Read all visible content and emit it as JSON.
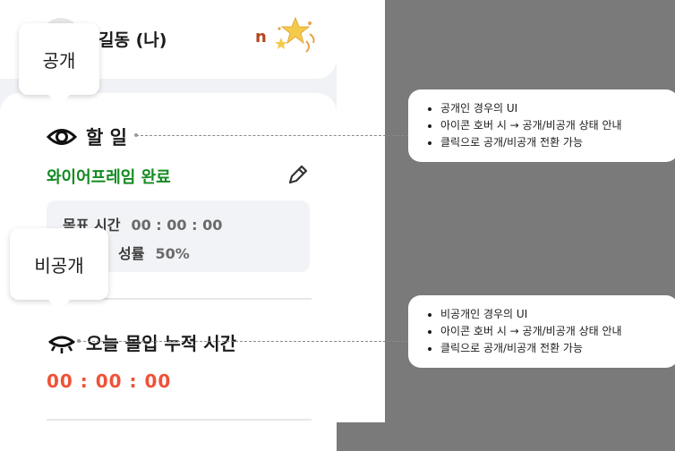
{
  "user": {
    "name": "길동 (나)",
    "mark": "n",
    "sparkle_icon": "sparkle-star-icon"
  },
  "task": {
    "title": "할 일",
    "status": "와이어프레임 완료",
    "edit_icon": "pencil-icon",
    "visibility_icon": "eye-open-icon"
  },
  "goal": {
    "time_label": "목표 시간",
    "time_value": "00 : 00 : 00",
    "rate_label": "성률",
    "rate_value": "50%"
  },
  "focus": {
    "title": "오늘 몰입 누적 시간",
    "time": "00 : 00 : 00",
    "visibility_icon": "eye-closed-icon"
  },
  "tooltips": {
    "public": "공개",
    "private": "비공개"
  },
  "notes": {
    "public": [
      "공개인 경우의 UI",
      "아이콘 호버 시 → 공개/비공개 상태 안내",
      "클릭으로 공개/비공개 전환 가능"
    ],
    "private": [
      "비공개인 경우의 UI",
      "아이콘 호버 시 → 공개/비공개 상태 안내",
      "클릭으로 공개/비공개 전환 가능"
    ]
  },
  "colors": {
    "status_green": "#138a21",
    "focus_time_red": "#ef5236",
    "mark_brown": "#b3441f",
    "annotation_bg": "#7a7a7a"
  }
}
